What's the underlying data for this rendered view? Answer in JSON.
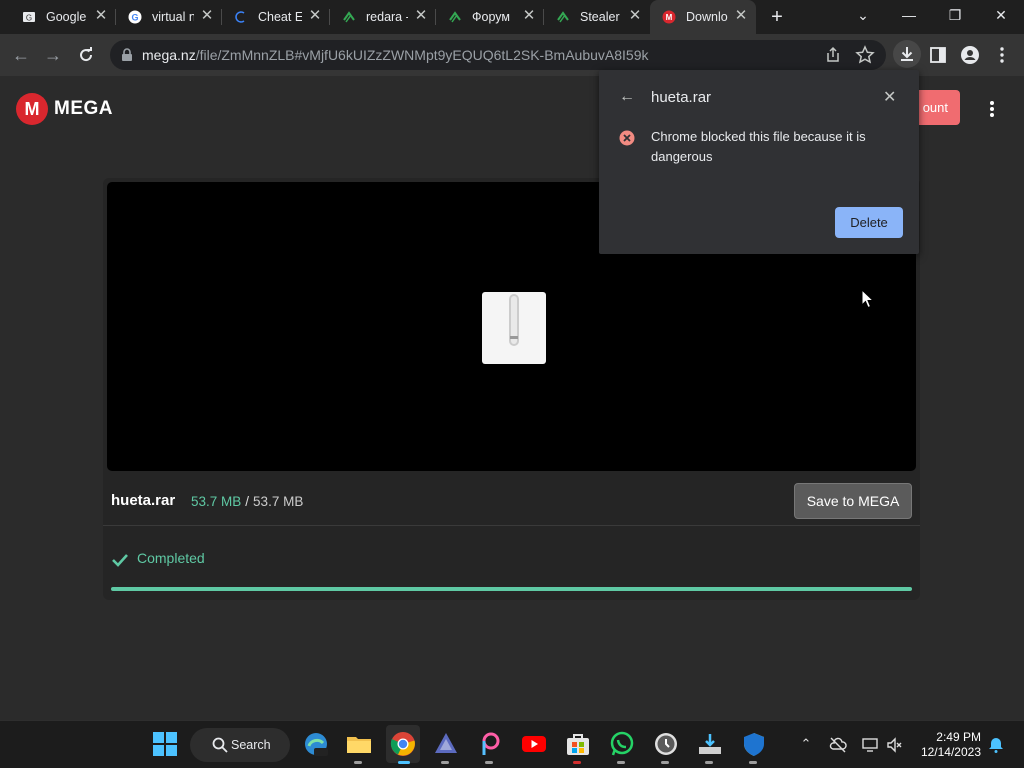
{
  "browser": {
    "tabs": [
      {
        "label": "Google",
        "icon": "gmail-favicon-icon"
      },
      {
        "label": "virtual n",
        "icon": "google-favicon-icon"
      },
      {
        "label": "Cheat E",
        "icon": "cheat-engine-favicon-icon"
      },
      {
        "label": "redara -",
        "icon": "forum-favicon-icon"
      },
      {
        "label": "Форум",
        "icon": "forum-favicon-icon"
      },
      {
        "label": "Stealer",
        "icon": "forum-favicon-icon"
      },
      {
        "label": "Downlo",
        "icon": "mega-favicon-icon",
        "active": true
      }
    ],
    "url_host": "mega.nz",
    "url_path": "/file/ZmMnnZLB#vMjfU6kUIZzZWNMpt9yEQUQ6tL2SK-BmAubuvA8I59k"
  },
  "mega": {
    "logo_text": "MEGA",
    "account_button": "ount",
    "file": {
      "name": "hueta.rar",
      "downloaded": "53.7 MB",
      "separator": "/",
      "total": "53.7 MB"
    },
    "save_button": "Save to MEGA",
    "status": "Completed",
    "progress": 1.0,
    "accent_color": "#5fc9a4",
    "brand_color": "#d9272e"
  },
  "download_popup": {
    "title": "hueta.rar",
    "message": "Chrome blocked this file because it is dangerous",
    "delete_button": "Delete"
  },
  "taskbar": {
    "search_label": "Search",
    "time": "2:49 PM",
    "date": "12/14/2023"
  }
}
